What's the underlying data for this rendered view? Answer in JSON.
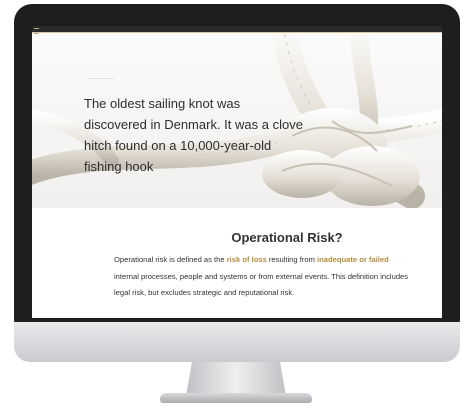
{
  "hero": {
    "text": "The oldest sailing knot was discovered in Denmark. It was a clove hitch found on a 10,000-year-old fishing hook"
  },
  "section": {
    "heading": "Operational Risk?",
    "p1": "Operational risk is defined as the ",
    "hl1": "risk of loss",
    "p2": " resulting from ",
    "hl2": "inadequate or failed",
    "p3": " internal processes, people and systems or from external events. This definition includes legal risk, but excludes strategic and reputational risk."
  },
  "colors": {
    "accent": "#b38e3c",
    "bezel": "#1d1e20"
  },
  "icons": [
    "menu-icon"
  ]
}
